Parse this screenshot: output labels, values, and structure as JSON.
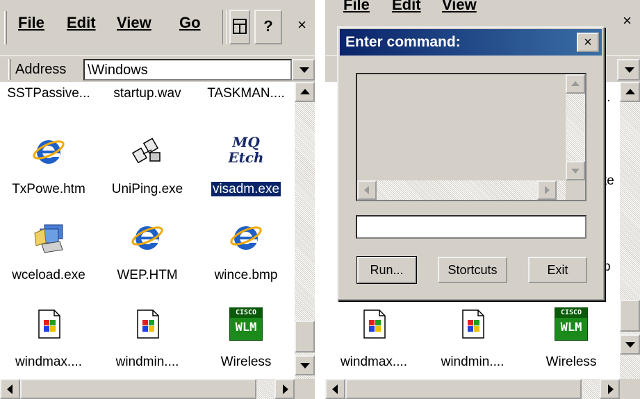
{
  "menu": {
    "file": "File",
    "edit": "Edit",
    "view": "View",
    "go": "Go",
    "help": "?",
    "close": "×"
  },
  "address": {
    "label": "Address",
    "value": "\\Windows"
  },
  "left_files": [
    {
      "label": "SSTPassive...",
      "icon": "file-icon"
    },
    {
      "label": "startup.wav",
      "icon": "sound-icon"
    },
    {
      "label": "TASKMAN....",
      "icon": "exe-icon"
    },
    {
      "label": "TxPowe.htm",
      "icon": "ie-icon"
    },
    {
      "label": "UniPing.exe",
      "icon": "network-icon"
    },
    {
      "label": "visadm.exe",
      "icon": "mq-etch-icon",
      "selected": true,
      "icon_text_1": "MQ",
      "icon_text_2": "Etch"
    },
    {
      "label": "wceload.exe",
      "icon": "install-icon"
    },
    {
      "label": "WEP.HTM",
      "icon": "ie-icon"
    },
    {
      "label": "wince.bmp",
      "icon": "ie-icon"
    },
    {
      "label": "windmax....",
      "icon": "windows-doc-icon"
    },
    {
      "label": "windmin....",
      "icon": "windows-doc-icon"
    },
    {
      "label": "Wireless",
      "icon": "cisco-wlm-icon",
      "icon_text_1": "CISCO",
      "icon_text_2": "WLM"
    }
  ],
  "right_partial": {
    "row1_end": "..",
    "row2_end": "te",
    "row3_end": "p"
  },
  "right_files": [
    {
      "label": "windmax....",
      "icon": "windows-doc-icon"
    },
    {
      "label": "windmin....",
      "icon": "windows-doc-icon"
    },
    {
      "label": "Wireless",
      "icon": "cisco-wlm-icon",
      "icon_text_1": "CISCO",
      "icon_text_2": "WLM"
    }
  ],
  "dialog": {
    "title": "Enter command:",
    "close": "×",
    "command_value": "",
    "run": "Run...",
    "shortcuts": "Stortcuts",
    "exit": "Exit"
  },
  "colors": {
    "face": "#d4d0c8",
    "title_start": "#0a246a",
    "title_end": "#3a6ea5",
    "ie_blue": "#1f5fc8",
    "cisco_green": "#1a8a1a"
  }
}
